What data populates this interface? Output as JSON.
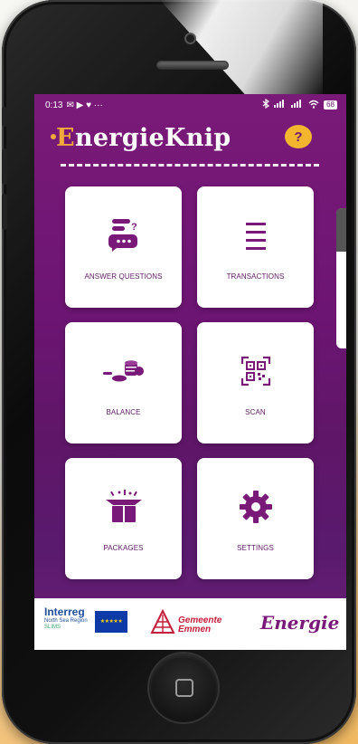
{
  "status_bar": {
    "time": "0:13",
    "left_icons": "✉ ▶ ♥ ···",
    "battery": "68"
  },
  "header": {
    "logo_first_letter": "E",
    "logo_rest": "nergieKnip",
    "help_label": "?"
  },
  "menu": [
    {
      "label": "ANSWER QUESTIONS",
      "icon": "chat-question-icon"
    },
    {
      "label": "TRANSACTIONS",
      "icon": "list-lines-icon"
    },
    {
      "label": "BALANCE",
      "icon": "coins-icon"
    },
    {
      "label": "SCAN",
      "icon": "qr-code-icon"
    },
    {
      "label": "PACKAGES",
      "icon": "gift-box-icon"
    },
    {
      "label": "SETTINGS",
      "icon": "gear-icon"
    }
  ],
  "footer": {
    "interreg_brand": "Interreg",
    "interreg_sub": "North Sea Region",
    "interreg_sub2": "SLIMS",
    "gemeente_name": "Gemeente",
    "gemeente_name2": "Emmen",
    "energie_brand": "Energie"
  },
  "colors": {
    "background_purple": "#6d1573",
    "accent_orange": "#f0a93c",
    "help_yellow": "#f4b52e",
    "tile_text": "#5f1a66"
  }
}
